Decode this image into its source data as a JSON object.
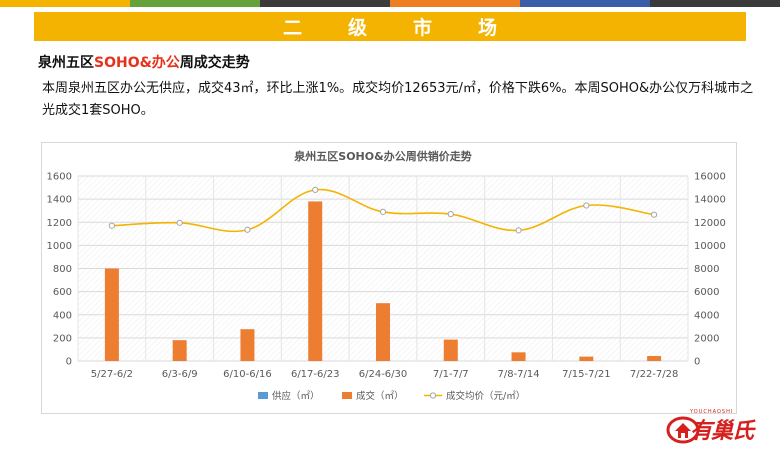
{
  "banner": {
    "title": "二级市场"
  },
  "heading": {
    "prefix": "泉州五区",
    "accent": "SOHO&办公",
    "suffix": "周成交走势"
  },
  "paragraph": "本周泉州五区办公无供应，成交43㎡，环比上涨1%。成交均价12653元/㎡，价格下跌6%。本周SOHO&办公仅万科城市之光成交1套SOHO。",
  "colors": {
    "banner": "#f5b301",
    "accent": "#e8311a",
    "supply": "#5b9bd5",
    "deal": "#ed7d31",
    "price": "#f5b301",
    "stripes": [
      "#f5b301",
      "#66a23a",
      "#3b3b3b",
      "#ef7d22",
      "#3a5ea8",
      "#3b3b3b"
    ]
  },
  "logo": {
    "text": "有巢氏",
    "sub": "YOUCHAOSHI",
    "icon": "house-logo-icon"
  },
  "chart_data": {
    "type": "bar",
    "title": "泉州五区SOHO&办公周供销价走势",
    "categories": [
      "5/27-6/2",
      "6/3-6/9",
      "6/10-6/16",
      "6/17-6/23",
      "6/24-6/30",
      "7/1-7/7",
      "7/8-7/14",
      "7/15-7/21",
      "7/22-7/28"
    ],
    "series": [
      {
        "name": "供应（㎡）",
        "type": "bar",
        "axis": "left",
        "values": [
          0,
          0,
          0,
          0,
          0,
          0,
          0,
          0,
          0
        ]
      },
      {
        "name": "成交（㎡）",
        "type": "bar",
        "axis": "left",
        "values": [
          800,
          180,
          275,
          1380,
          500,
          185,
          75,
          38,
          43
        ]
      },
      {
        "name": "成交均价（元/㎡）",
        "type": "line",
        "axis": "right",
        "values": [
          11700,
          11950,
          11350,
          14800,
          12900,
          12700,
          11300,
          13450,
          12653
        ]
      }
    ],
    "ylim": [
      0,
      1600
    ],
    "y2lim": [
      0,
      16000
    ],
    "yticks": [
      "0",
      "200",
      "400",
      "600",
      "800",
      "1000",
      "1200",
      "1400",
      "1600"
    ],
    "y2ticks": [
      "0",
      "2000",
      "4000",
      "6000",
      "8000",
      "10000",
      "12000",
      "14000",
      "16000"
    ],
    "grid": true,
    "legend": "bottom"
  }
}
